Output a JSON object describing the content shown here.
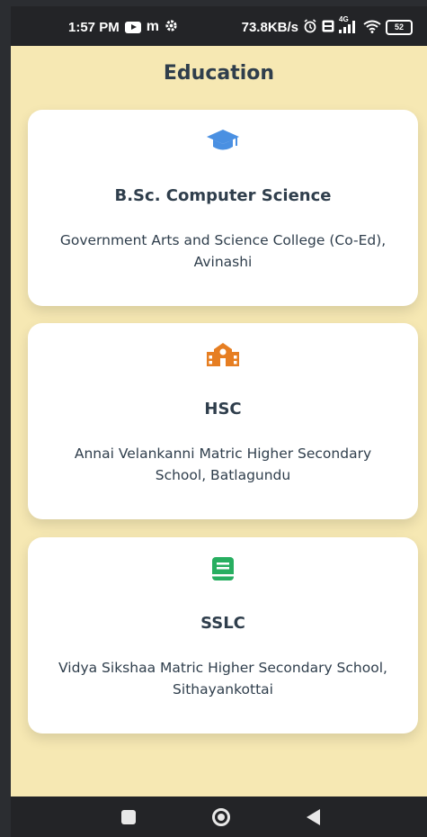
{
  "status_bar": {
    "time": "1:57 PM",
    "carrier_glyph": "m",
    "network_speed": "73.8KB/s",
    "battery_level": "52",
    "network_type": "4G",
    "icons": [
      "youtube-icon",
      "settings-icon",
      "alarm-icon",
      "volte-icon",
      "signal-icon",
      "wifi-icon",
      "battery-icon"
    ]
  },
  "page": {
    "title": "Education"
  },
  "education": [
    {
      "icon": "graduation-cap-icon",
      "icon_color": "#4a90e2",
      "title": "B.Sc. Computer Science",
      "institution": "Government Arts and Science College (Co-Ed), Avinashi"
    },
    {
      "icon": "school-icon",
      "icon_color": "#e67e22",
      "title": "HSC",
      "institution": "Annai Velankanni Matric Higher Secondary School, Batlagundu"
    },
    {
      "icon": "book-icon",
      "icon_color": "#27ae60",
      "title": "SSLC",
      "institution": "Vidya Sikshaa Matric Higher Secondary School, Sithayankottai"
    }
  ],
  "colors": {
    "background": "#f6e8b3",
    "card": "#ffffff",
    "text": "#2f3e4c",
    "system_bar": "#232427"
  },
  "nav_bar": {
    "buttons": [
      "recents-button",
      "home-button",
      "back-button"
    ]
  }
}
